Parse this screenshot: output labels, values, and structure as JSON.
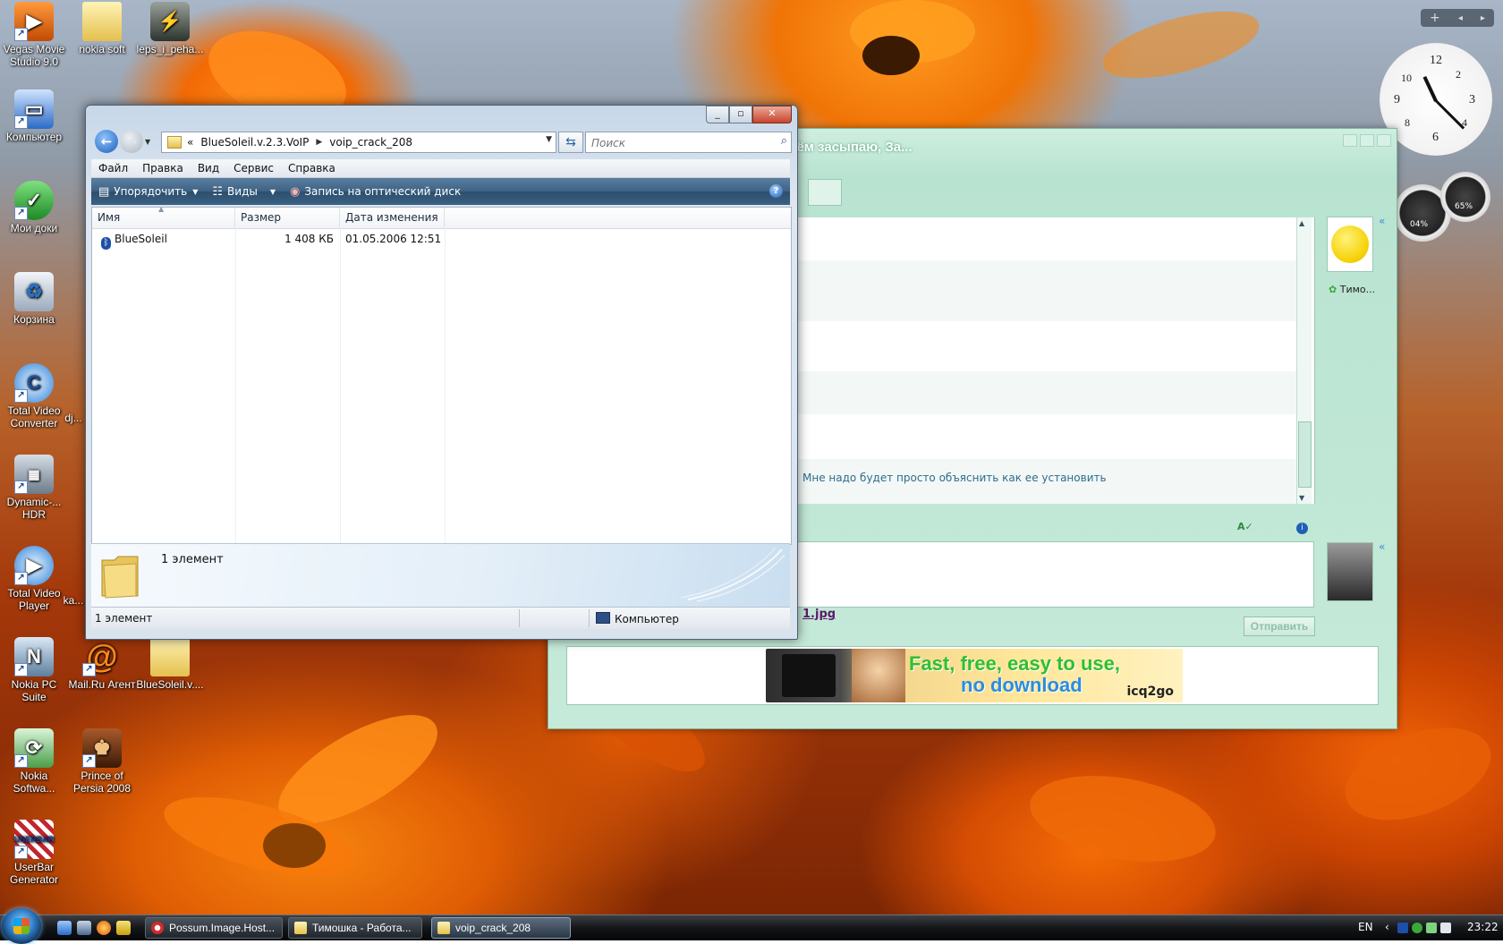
{
  "desktop": {
    "icons": [
      {
        "label": "Vegas Movie Studio 9.0"
      },
      {
        "label": "nokia soft"
      },
      {
        "label": "leps_i_peha..."
      },
      {
        "label": "Компьютер"
      },
      {
        "label": "Мои доки"
      },
      {
        "label": "Корзина"
      },
      {
        "label": "Total Video Converter"
      },
      {
        "label": "dj..."
      },
      {
        "label": "Dynamic-... HDR"
      },
      {
        "label": "Total Video Player"
      },
      {
        "label": "ka..."
      },
      {
        "label": "Nokia PC Suite"
      },
      {
        "label": "Mail.Ru Агент"
      },
      {
        "label": "BlueSoleil.v...."
      },
      {
        "label": "Nokia Softwa..."
      },
      {
        "label": "Prince of Persia 2008"
      },
      {
        "label": "UserBar Generator"
      }
    ]
  },
  "icq_window": {
    "title": "зём засыпаю, За...",
    "message": "Мне надо будет просто объяснить как ее установить",
    "file_link": "1.jpg",
    "send_label": "Отправить",
    "contact_name": "Тимо...",
    "ad": {
      "line1": "Fast, free, easy to use,",
      "line2": "no download",
      "brand": "icq2go"
    }
  },
  "explorer": {
    "breadcrumb": {
      "prefix": "«",
      "parts": [
        "BlueSoleil.v.2.3.VoIP",
        "voip_crack_208"
      ]
    },
    "search_placeholder": "Поиск",
    "menu": [
      "Файл",
      "Правка",
      "Вид",
      "Сервис",
      "Справка"
    ],
    "toolbar": {
      "organize": "Упорядочить",
      "views": "Виды",
      "burn": "Запись на оптический диск",
      "help": "?"
    },
    "columns": [
      "Имя",
      "Размер",
      "Дата изменения"
    ],
    "rows": [
      {
        "name": "BlueSoleil",
        "size": "1 408 КБ",
        "modified": "01.05.2006 12:51"
      }
    ],
    "details_count": "1 элемент",
    "status": {
      "count": "1 элемент",
      "location": "Компьютер"
    }
  },
  "taskbar": {
    "tasks": [
      {
        "label": "Possum.Image.Host..."
      },
      {
        "label": "Тимошка - Работа..."
      },
      {
        "label": "voip_crack_208"
      }
    ],
    "language": "EN",
    "time": "23:22"
  },
  "gadgets": {
    "cpu_percent": "04%",
    "mem_percent": "65%"
  },
  "colors": {
    "explorer_toolbar": "#3e6385",
    "icq_accent": "#b9e3d1",
    "taskbar": "#141618"
  }
}
